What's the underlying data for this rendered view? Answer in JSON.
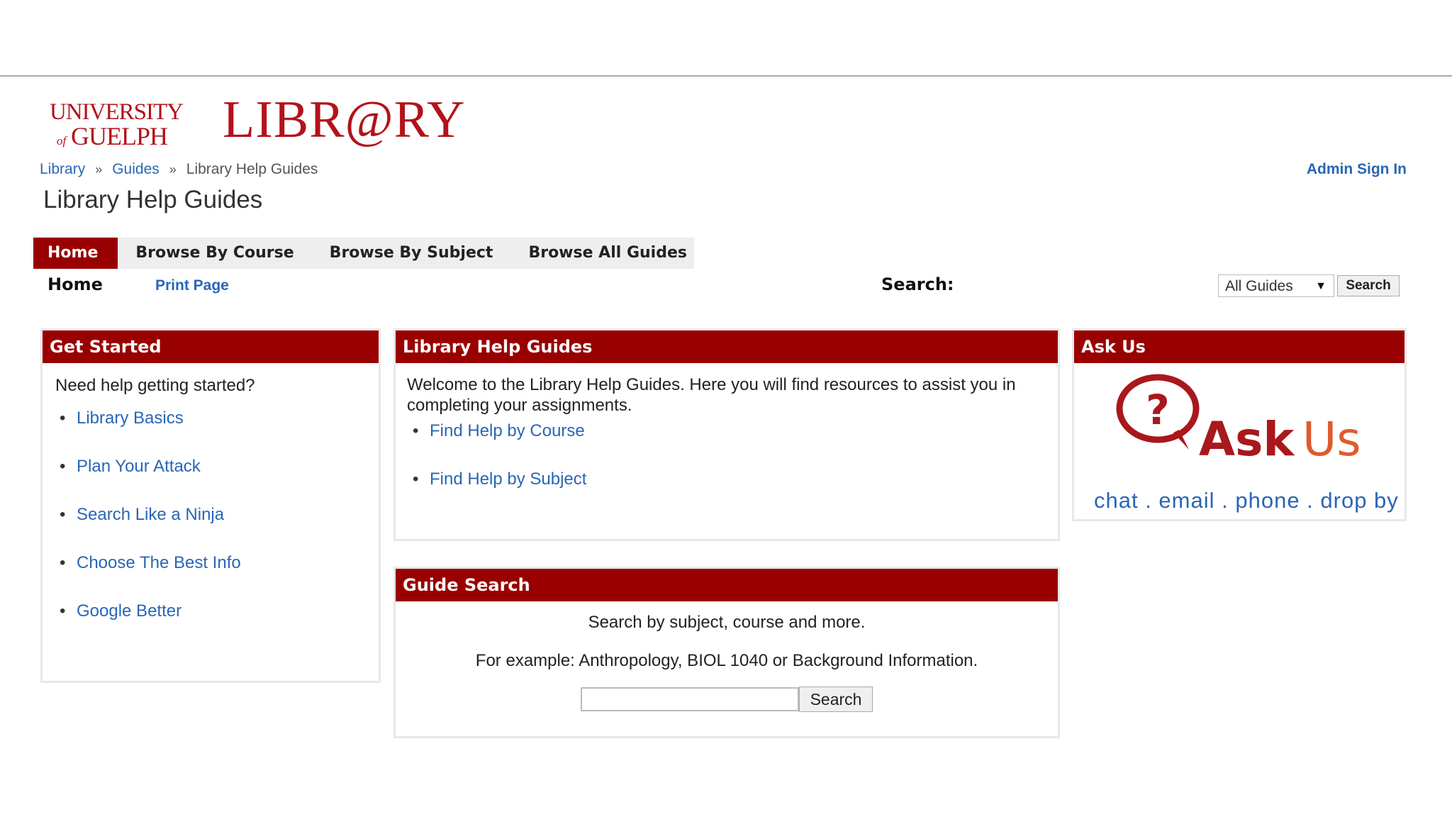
{
  "header": {
    "university_logo_text": "UNIVERSITY of GUELPH",
    "library_logo_text": "LIBR@RY"
  },
  "breadcrumb": {
    "items": [
      "Library",
      "Guides",
      "Library Help Guides"
    ],
    "separator": "»"
  },
  "admin_link": "Admin Sign In",
  "page_title": "Library Help Guides",
  "tabs": [
    {
      "label": "Home",
      "active": true
    },
    {
      "label": "Browse By Course"
    },
    {
      "label": "Browse By Subject"
    },
    {
      "label": "Browse All Guides"
    }
  ],
  "subnav": {
    "current": "Home",
    "print": "Print Page",
    "search_label": "Search:",
    "scope_value": "All Guides",
    "search_button": "Search"
  },
  "get_started": {
    "title": "Get Started",
    "intro": "Need help getting started?",
    "links": [
      "Library Basics",
      "Plan Your Attack",
      "Search Like a Ninja",
      "Choose The Best Info",
      "Google Better"
    ]
  },
  "help_guides": {
    "title": "Library Help Guides",
    "welcome": "Welcome to the Library Help Guides. Here you will find resources to assist you in completing your assignments.",
    "links": [
      "Find Help by Course",
      "Find Help by Subject"
    ]
  },
  "ask_us": {
    "title": "Ask Us",
    "logo_text_1": "Ask",
    "logo_text_2": "Us",
    "tagline": "chat . email . phone . drop by"
  },
  "guide_search": {
    "title": "Guide Search",
    "line1": "Search by subject, course and more.",
    "line2": "For example: Anthropology, BIOL 1040 or Background Information.",
    "button": "Search"
  },
  "colors": {
    "brand_red": "#990000",
    "link_blue": "#2a66b5"
  }
}
